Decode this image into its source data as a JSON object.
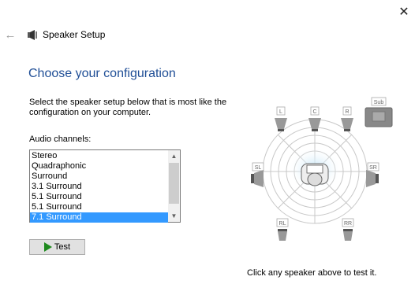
{
  "window": {
    "title": "Speaker Setup",
    "close_label": "✕",
    "back_label": "←"
  },
  "heading": "Choose your configuration",
  "description": "Select the speaker setup below that is most like the configuration on your computer.",
  "audio_channels": {
    "label": "Audio channels:",
    "items": [
      "Stereo",
      "Quadraphonic",
      "Surround",
      "3.1 Surround",
      "5.1 Surround",
      "5.1 Surround",
      "7.1 Surround"
    ],
    "selected": "7.1 Surround"
  },
  "test_button": {
    "label": "Test"
  },
  "speakers": {
    "front_left": "L",
    "center": "C",
    "front_right": "R",
    "subwoofer": "Sub",
    "side_left": "SL",
    "side_right": "SR",
    "rear_left": "RL",
    "rear_right": "RR"
  },
  "hint": "Click any speaker above to test it.",
  "colors": {
    "heading": "#1f4e96",
    "selection": "#3399ff",
    "play_icon": "#1f8a1f"
  }
}
